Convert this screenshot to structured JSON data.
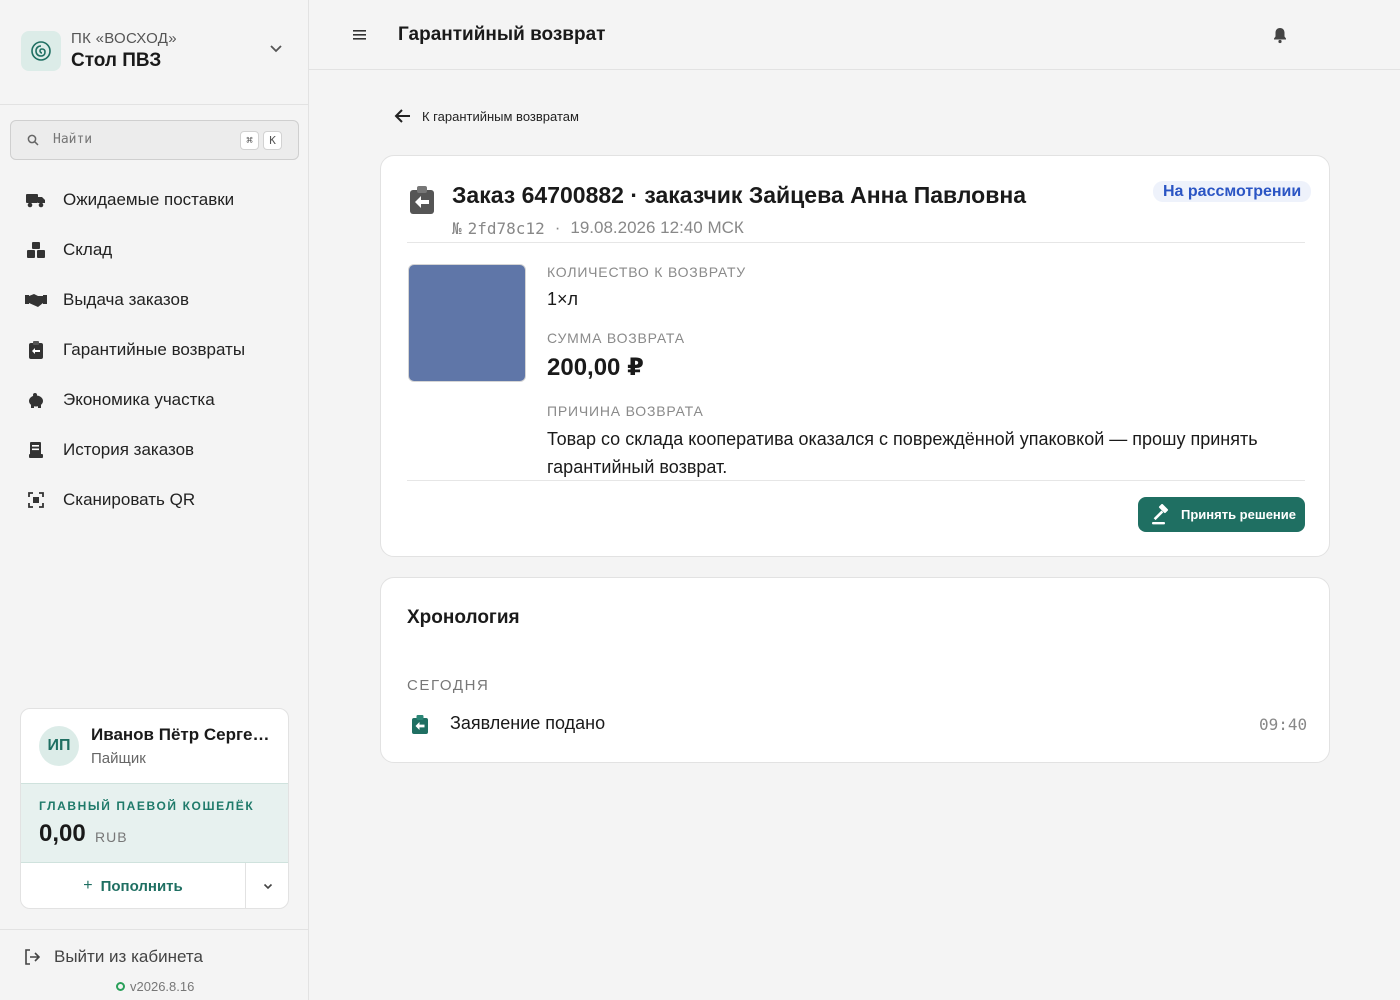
{
  "sidebar": {
    "org": {
      "subtitle": "ПК «ВОСХОД»",
      "name": "Стол ПВЗ"
    },
    "search": {
      "placeholder": "Найти",
      "kbd_mod": "⌘",
      "kbd_key": "K"
    },
    "nav": [
      {
        "label": "Ожидаемые поставки",
        "icon": "truck-icon"
      },
      {
        "label": "Склад",
        "icon": "boxes-icon"
      },
      {
        "label": "Выдача заказов",
        "icon": "handshake-icon"
      },
      {
        "label": "Гарантийные возвраты",
        "icon": "clipboard-return-icon"
      },
      {
        "label": "Экономика участка",
        "icon": "piggy-bank-icon"
      },
      {
        "label": "История заказов",
        "icon": "receipt-icon"
      },
      {
        "label": "Сканировать QR",
        "icon": "qr-scan-icon"
      }
    ],
    "user": {
      "initials": "ИП",
      "name": "Иванов Пётр Сергеевич",
      "role": "Пайщик",
      "wallet_label": "ГЛАВНЫЙ ПАЕВОЙ КОШЕЛЁК",
      "wallet_amount": "0,00",
      "wallet_currency": "RUB",
      "topup_label": "Пополнить"
    },
    "logout_label": "Выйти из кабинета",
    "version": "v2026.8.16"
  },
  "topbar": {
    "title": "Гарантийный возврат"
  },
  "back_label": "К гарантийным возвратам",
  "order": {
    "title": "Заказ 64700882 · заказчик Зайцева Анна Павловна",
    "number_prefix": "№",
    "hash": "2fd78c12",
    "separator": "·",
    "datetime": "19.08.2026 12:40 МСК",
    "status": "На рассмотрении",
    "qty_label": "КОЛИЧЕСТВО К ВОЗВРАТУ",
    "qty_value": "1×л",
    "sum_label": "СУММА ВОЗВРАТА",
    "sum_value": "200,00 ₽",
    "reason_label": "ПРИЧИНА ВОЗВРАТА",
    "reason_text": "Товар со склада кооператива оказался с повреждённой упаковкой — прошу принять гарантийный возврат.",
    "decide_label": "Принять решение"
  },
  "timeline": {
    "title": "Хронология",
    "day": "СЕГОДНЯ",
    "events": [
      {
        "label": "Заявление подано",
        "time": "09:40",
        "icon": "clipboard-return-icon"
      }
    ]
  },
  "colors": {
    "accent": "#1f6f62",
    "status_blue": "#2b55c4",
    "thumb": "#5f76a8"
  }
}
